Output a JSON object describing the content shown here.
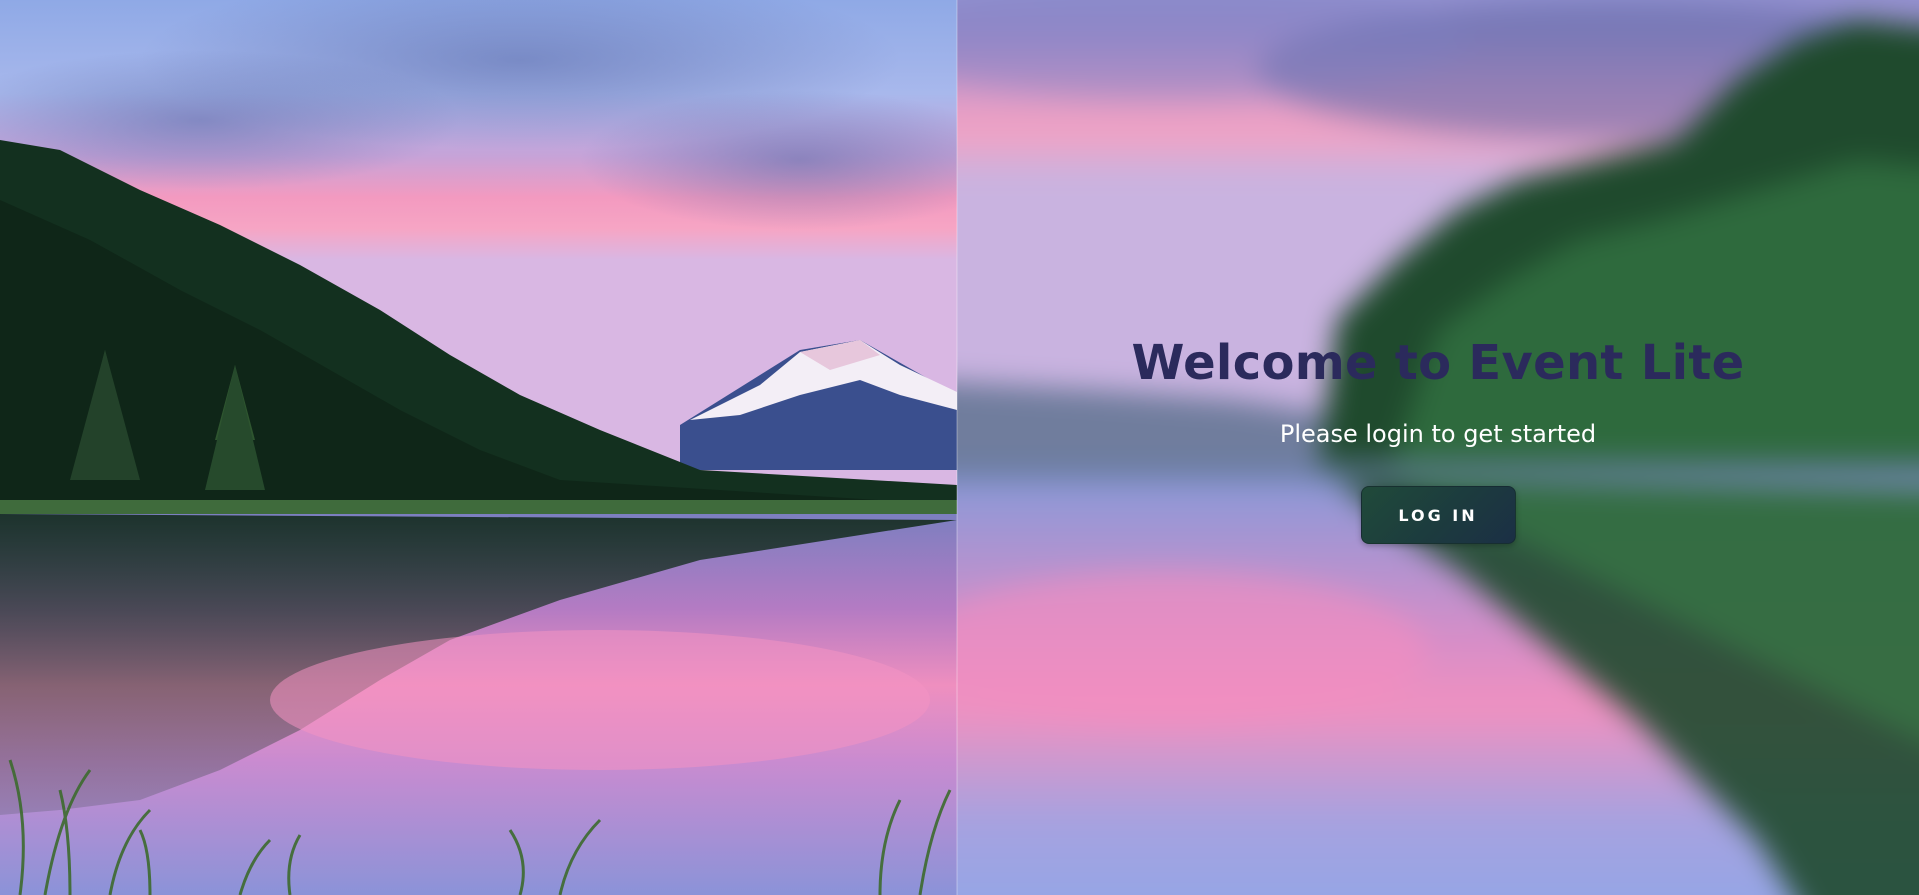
{
  "login": {
    "title": "Welcome to Event Lite",
    "subtitle": "Please login to get started",
    "button_label": "LOG IN"
  },
  "colors": {
    "title": "#2b2a5c",
    "button_start": "#204a3a",
    "button_end": "#1b2f45",
    "subtitle": "#ffffff"
  }
}
